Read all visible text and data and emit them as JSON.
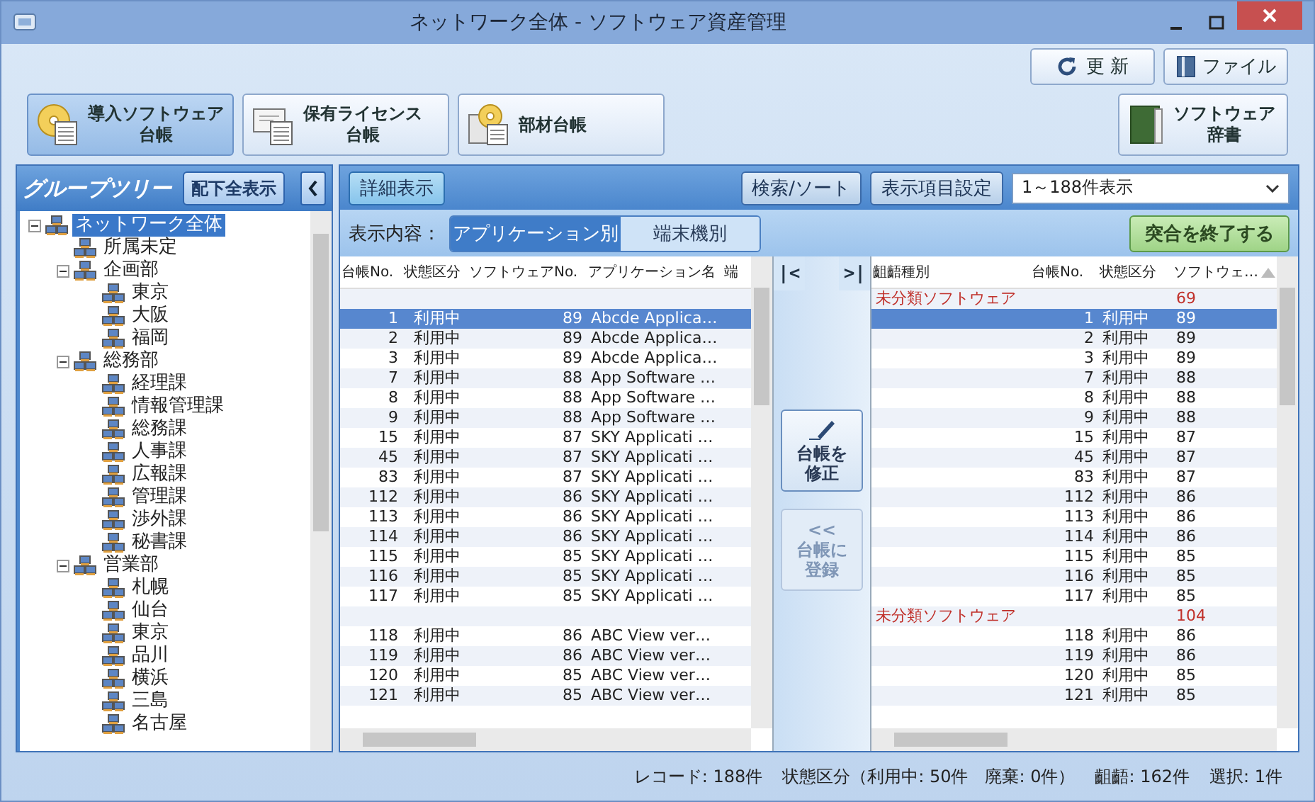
{
  "window": {
    "title": "ネットワーク全体 - ソフトウェア資産管理"
  },
  "toolbar": {
    "buttons": [
      {
        "kind": "refresh",
        "label": "更 新"
      },
      {
        "kind": "file",
        "label": "ファイル"
      }
    ]
  },
  "ledger_buttons": [
    {
      "kind": "installed",
      "label": [
        "導入ソフトウェア",
        "台帳"
      ],
      "selected": true
    },
    {
      "kind": "license",
      "label": [
        "保有ライセンス",
        "台帳"
      ],
      "selected": false
    },
    {
      "kind": "parts",
      "label": [
        "部材台帳"
      ],
      "selected": false
    }
  ],
  "dictionary_button": {
    "label": [
      "ソフトウェア",
      "辞書"
    ]
  },
  "group_tree": {
    "title": "グループツリー",
    "show_all_button": "配下全表示",
    "nodes": [
      {
        "label": "ネットワーク全体",
        "selected": true,
        "expanded": true,
        "children": [
          {
            "label": "所属未定",
            "selected": false
          },
          {
            "label": "企画部",
            "selected": false,
            "expanded": true,
            "children": [
              {
                "label": "東京",
                "selected": false
              },
              {
                "label": "大阪",
                "selected": false
              },
              {
                "label": "福岡",
                "selected": false
              }
            ]
          },
          {
            "label": "総務部",
            "selected": false,
            "expanded": true,
            "children": [
              {
                "label": "経理課",
                "selected": false
              },
              {
                "label": "情報管理課",
                "selected": false
              },
              {
                "label": "総務課",
                "selected": false
              },
              {
                "label": "人事課",
                "selected": false
              },
              {
                "label": "広報課",
                "selected": false
              },
              {
                "label": "管理課",
                "selected": false
              },
              {
                "label": "渉外課",
                "selected": false
              },
              {
                "label": "秘書課",
                "selected": false
              }
            ]
          },
          {
            "label": "営業部",
            "selected": false,
            "expanded": true,
            "children": [
              {
                "label": "札幌",
                "selected": false
              },
              {
                "label": "仙台",
                "selected": false
              },
              {
                "label": "東京",
                "selected": false
              },
              {
                "label": "品川",
                "selected": false
              },
              {
                "label": "横浜",
                "selected": false
              },
              {
                "label": "三島",
                "selected": false
              },
              {
                "label": "名古屋",
                "selected": false
              }
            ]
          }
        ]
      }
    ]
  },
  "detail_panel": {
    "detail_button": {
      "label": "詳細表示",
      "on": true
    },
    "search_button": "検索/ソート",
    "columns_button": "表示項目設定",
    "range_select": {
      "value": "1～188件表示"
    },
    "view_label": "表示内容：",
    "view_tabs": [
      {
        "label": "アプリケーション別",
        "selected": true
      },
      {
        "label": "端末機別",
        "selected": false
      }
    ],
    "finish_button": "突合を終了する"
  },
  "left_table": {
    "columns": [
      "台帳No.",
      "状態区分",
      "ソフトウェアNo.",
      "アプリケーション名",
      "端"
    ],
    "rows": [
      {
        "kind": "group"
      },
      {
        "kind": "item",
        "selected": true,
        "ledger_no": "1",
        "status": "利用中",
        "software_no": "89",
        "app_name": "Abcde Applica…"
      },
      {
        "kind": "item",
        "selected": false,
        "ledger_no": "2",
        "status": "利用中",
        "software_no": "89",
        "app_name": "Abcde Applica…"
      },
      {
        "kind": "item",
        "selected": false,
        "ledger_no": "3",
        "status": "利用中",
        "software_no": "89",
        "app_name": "Abcde Applica…"
      },
      {
        "kind": "item",
        "selected": false,
        "ledger_no": "7",
        "status": "利用中",
        "software_no": "88",
        "app_name": "App Software …"
      },
      {
        "kind": "item",
        "selected": false,
        "ledger_no": "8",
        "status": "利用中",
        "software_no": "88",
        "app_name": "App Software …"
      },
      {
        "kind": "item",
        "selected": false,
        "ledger_no": "9",
        "status": "利用中",
        "software_no": "88",
        "app_name": "App Software …"
      },
      {
        "kind": "item",
        "selected": false,
        "ledger_no": "15",
        "status": "利用中",
        "software_no": "87",
        "app_name": "SKY Applicati …"
      },
      {
        "kind": "item",
        "selected": false,
        "ledger_no": "45",
        "status": "利用中",
        "software_no": "87",
        "app_name": "SKY Applicati …"
      },
      {
        "kind": "item",
        "selected": false,
        "ledger_no": "83",
        "status": "利用中",
        "software_no": "87",
        "app_name": "SKY Applicati …"
      },
      {
        "kind": "item",
        "selected": false,
        "ledger_no": "112",
        "status": "利用中",
        "software_no": "86",
        "app_name": "SKY Applicati …"
      },
      {
        "kind": "item",
        "selected": false,
        "ledger_no": "113",
        "status": "利用中",
        "software_no": "86",
        "app_name": "SKY Applicati …"
      },
      {
        "kind": "item",
        "selected": false,
        "ledger_no": "114",
        "status": "利用中",
        "software_no": "86",
        "app_name": "SKY Applicati …"
      },
      {
        "kind": "item",
        "selected": false,
        "ledger_no": "115",
        "status": "利用中",
        "software_no": "85",
        "app_name": "SKY Applicati …"
      },
      {
        "kind": "item",
        "selected": false,
        "ledger_no": "116",
        "status": "利用中",
        "software_no": "85",
        "app_name": "SKY Applicati …"
      },
      {
        "kind": "item",
        "selected": false,
        "ledger_no": "117",
        "status": "利用中",
        "software_no": "85",
        "app_name": "SKY Applicati …"
      },
      {
        "kind": "group"
      },
      {
        "kind": "item",
        "selected": false,
        "ledger_no": "118",
        "status": "利用中",
        "software_no": "86",
        "app_name": "ABC View ver…"
      },
      {
        "kind": "item",
        "selected": false,
        "ledger_no": "119",
        "status": "利用中",
        "software_no": "86",
        "app_name": "ABC View ver…"
      },
      {
        "kind": "item",
        "selected": false,
        "ledger_no": "120",
        "status": "利用中",
        "software_no": "85",
        "app_name": "ABC View ver…"
      },
      {
        "kind": "item",
        "selected": false,
        "ledger_no": "121",
        "status": "利用中",
        "software_no": "85",
        "app_name": "ABC View ver…"
      }
    ]
  },
  "nav": {
    "first": "|<",
    "last": ">|"
  },
  "actions": [
    {
      "kind": "edit",
      "label": [
        "台帳を",
        "修正"
      ],
      "disabled": false
    },
    {
      "kind": "register",
      "label": [
        "<<",
        "台帳に",
        "登録"
      ],
      "disabled": true
    }
  ],
  "right_table": {
    "columns": [
      "齟齬種別",
      "台帳No.",
      "状態区分",
      "ソフトウェ…"
    ],
    "rows": [
      {
        "kind": "group",
        "mismatch_type": "未分類ソフトウェア",
        "software_no": "69"
      },
      {
        "kind": "item",
        "selected": true,
        "ledger_no": "1",
        "status": "利用中",
        "software_no": "89"
      },
      {
        "kind": "item",
        "selected": false,
        "ledger_no": "2",
        "status": "利用中",
        "software_no": "89"
      },
      {
        "kind": "item",
        "selected": false,
        "ledger_no": "3",
        "status": "利用中",
        "software_no": "89"
      },
      {
        "kind": "item",
        "selected": false,
        "ledger_no": "7",
        "status": "利用中",
        "software_no": "88"
      },
      {
        "kind": "item",
        "selected": false,
        "ledger_no": "8",
        "status": "利用中",
        "software_no": "88"
      },
      {
        "kind": "item",
        "selected": false,
        "ledger_no": "9",
        "status": "利用中",
        "software_no": "88"
      },
      {
        "kind": "item",
        "selected": false,
        "ledger_no": "15",
        "status": "利用中",
        "software_no": "87"
      },
      {
        "kind": "item",
        "selected": false,
        "ledger_no": "45",
        "status": "利用中",
        "software_no": "87"
      },
      {
        "kind": "item",
        "selected": false,
        "ledger_no": "83",
        "status": "利用中",
        "software_no": "87"
      },
      {
        "kind": "item",
        "selected": false,
        "ledger_no": "112",
        "status": "利用中",
        "software_no": "86"
      },
      {
        "kind": "item",
        "selected": false,
        "ledger_no": "113",
        "status": "利用中",
        "software_no": "86"
      },
      {
        "kind": "item",
        "selected": false,
        "ledger_no": "114",
        "status": "利用中",
        "software_no": "86"
      },
      {
        "kind": "item",
        "selected": false,
        "ledger_no": "115",
        "status": "利用中",
        "software_no": "85"
      },
      {
        "kind": "item",
        "selected": false,
        "ledger_no": "116",
        "status": "利用中",
        "software_no": "85"
      },
      {
        "kind": "item",
        "selected": false,
        "ledger_no": "117",
        "status": "利用中",
        "software_no": "85"
      },
      {
        "kind": "group",
        "mismatch_type": "未分類ソフトウェア",
        "software_no": "104"
      },
      {
        "kind": "item",
        "selected": false,
        "ledger_no": "118",
        "status": "利用中",
        "software_no": "86"
      },
      {
        "kind": "item",
        "selected": false,
        "ledger_no": "119",
        "status": "利用中",
        "software_no": "86"
      },
      {
        "kind": "item",
        "selected": false,
        "ledger_no": "120",
        "status": "利用中",
        "software_no": "85"
      },
      {
        "kind": "item",
        "selected": false,
        "ledger_no": "121",
        "status": "利用中",
        "software_no": "85"
      }
    ]
  },
  "status_bar": [
    "レコード: 188件",
    "状態区分（利用中: 50件　廃棄: 0件）",
    "齟齬: 162件",
    "選択: 1件"
  ]
}
